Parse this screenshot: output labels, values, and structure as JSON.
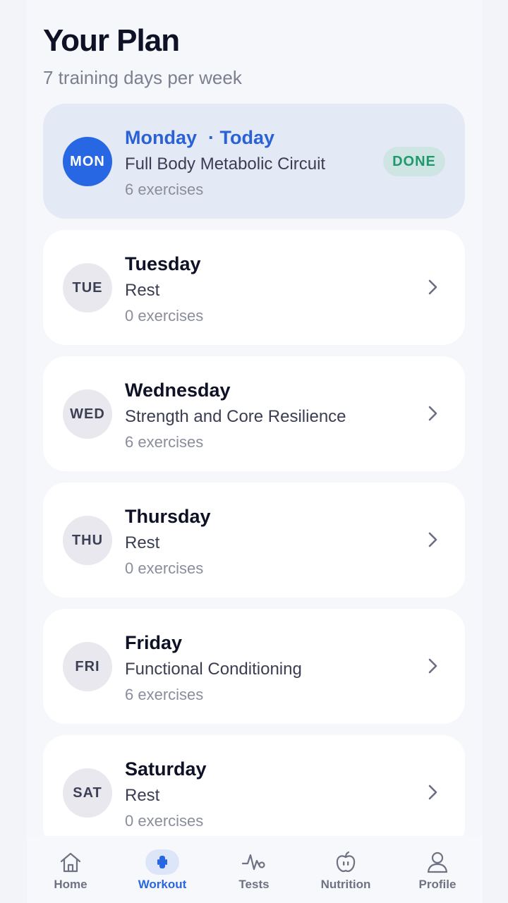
{
  "header": {
    "title": "Your Plan",
    "subtitle": "7 training days per week"
  },
  "days": [
    {
      "abbr": "MON",
      "name": "Monday",
      "today_tag": "· Today",
      "workout": "Full Body Metabolic Circuit",
      "count": "6 exercises",
      "status": "DONE"
    },
    {
      "abbr": "TUE",
      "name": "Tuesday",
      "workout": "Rest",
      "count": "0 exercises"
    },
    {
      "abbr": "WED",
      "name": "Wednesday",
      "workout": "Strength and Core Resilience",
      "count": "6 exercises"
    },
    {
      "abbr": "THU",
      "name": "Thursday",
      "workout": "Rest",
      "count": "0 exercises"
    },
    {
      "abbr": "FRI",
      "name": "Friday",
      "workout": "Functional Conditioning",
      "count": "6 exercises"
    },
    {
      "abbr": "SAT",
      "name": "Saturday",
      "workout": "Rest",
      "count": "0 exercises"
    }
  ],
  "nav": [
    {
      "label": "Home",
      "icon": "home-icon"
    },
    {
      "label": "Workout",
      "icon": "dumbbell-icon",
      "active": true
    },
    {
      "label": "Tests",
      "icon": "pulse-icon"
    },
    {
      "label": "Nutrition",
      "icon": "apple-icon"
    },
    {
      "label": "Profile",
      "icon": "person-icon"
    }
  ],
  "colors": {
    "accent": "#2767e4",
    "today_card": "#e3eaf6",
    "done_badge_bg": "#cfe5e3",
    "done_badge_text": "#1d9a6b"
  }
}
